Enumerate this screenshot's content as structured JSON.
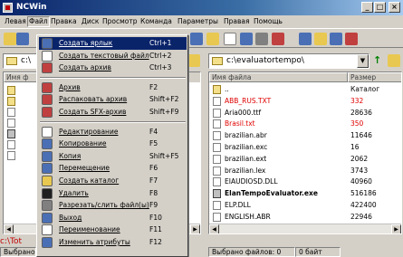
{
  "window": {
    "title": "NCWin"
  },
  "menu": [
    "Левая",
    "Файл",
    "Правка",
    "Диск",
    "Просмотр",
    "Команда",
    "Параметры",
    "Правая",
    "Помощь"
  ],
  "left_panel": {
    "path": "c:\\",
    "header": {
      "name": "Имя ф",
      "size": ""
    },
    "cmdline": "c:\\Tot"
  },
  "right_panel": {
    "path": "c:\\evaluatortempo\\",
    "header": {
      "name": "Имя файла",
      "size": "Размер"
    },
    "files": [
      {
        "name": "..",
        "size": "Каталог",
        "style": "dir"
      },
      {
        "name": "ABB_RUS.TXT",
        "size": "332",
        "style": "red"
      },
      {
        "name": "Aria000.ttf",
        "size": "28636",
        "style": ""
      },
      {
        "name": "Brasil.txt",
        "size": "350",
        "style": "red"
      },
      {
        "name": "brazilian.abr",
        "size": "11646",
        "style": ""
      },
      {
        "name": "brazilian.exc",
        "size": "16",
        "style": ""
      },
      {
        "name": "brazilian.ext",
        "size": "2062",
        "style": ""
      },
      {
        "name": "brazilian.lex",
        "size": "3743",
        "style": ""
      },
      {
        "name": "EIAUDIOSD.DLL",
        "size": "40960",
        "style": ""
      },
      {
        "name": "ElanTempoEvaluator.exe",
        "size": "516186",
        "style": "bold"
      },
      {
        "name": "ELP.DLL",
        "size": "422400",
        "style": ""
      },
      {
        "name": "ENGLISH.ABR",
        "size": "22946",
        "style": ""
      }
    ]
  },
  "file_menu": [
    {
      "label": "Создать ярлык",
      "key": "Ctrl+1",
      "selected": true,
      "icon_color": "#4a6fb5"
    },
    {
      "label": "Создать текстовый файл",
      "key": "Ctrl+2",
      "icon_color": "#ffffff"
    },
    {
      "label": "Создать архив",
      "key": "Ctrl+3",
      "icon_color": "#c04040"
    },
    {
      "sep": true
    },
    {
      "label": "Архив",
      "key": "F2",
      "icon_color": "#c04040"
    },
    {
      "label": "Распаковать архив",
      "key": "Shift+F2",
      "icon_color": "#c04040"
    },
    {
      "label": "Создать SFX-архив",
      "key": "Shift+F9",
      "icon_color": "#c04040"
    },
    {
      "sep": true
    },
    {
      "label": "Редактирование",
      "key": "F4",
      "icon_color": "#ffffff"
    },
    {
      "label": "Копирование",
      "key": "F5",
      "icon_color": "#4a6fb5"
    },
    {
      "label": "Копия",
      "key": "Shift+F5",
      "icon_color": "#4a6fb5"
    },
    {
      "label": "Перемещение",
      "key": "F6",
      "icon_color": "#4a6fb5"
    },
    {
      "label": "Создать каталог",
      "key": "F7",
      "icon_color": "#e8c850"
    },
    {
      "label": "Удалить",
      "key": "F8",
      "icon_color": "#202020"
    },
    {
      "label": "Разрезать/слить файл(ы)",
      "key": "F9",
      "icon_color": "#808080"
    },
    {
      "label": "Выход",
      "key": "F10",
      "icon_color": "#4a6fb5"
    },
    {
      "label": "Переименование",
      "key": "F11",
      "icon_color": "#ffffff"
    },
    {
      "label": "Изменить атрибуты",
      "key": "F12",
      "icon_color": "#4a6fb5"
    }
  ],
  "status": {
    "left": "Выбрано",
    "right_selected": "Выбрано файлов: 0",
    "right_bytes": "0 байт"
  }
}
